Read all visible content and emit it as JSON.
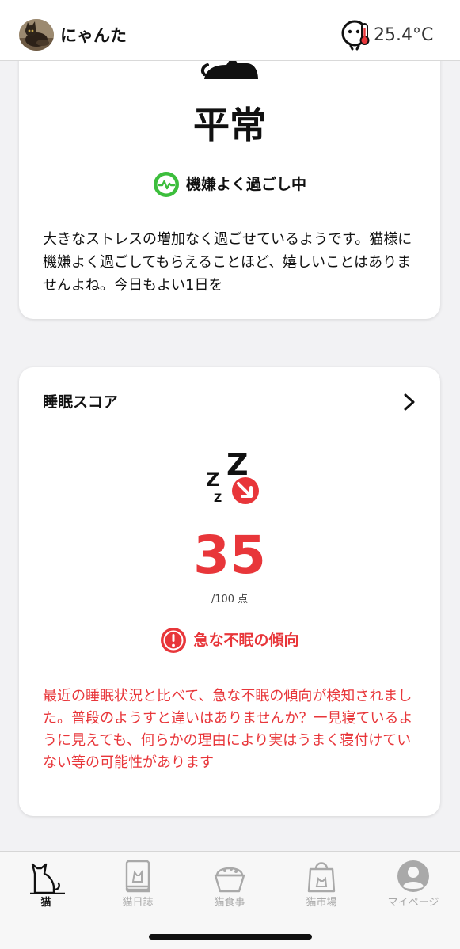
{
  "header": {
    "cat_name": "にゃんた",
    "temperature": "25.4°C"
  },
  "stress_card": {
    "level": "平常",
    "status": "機嫌よく過ごし中",
    "description": "大きなストレスの増加なく過ごせているようです。猫様に機嫌よく過ごしてもらえることほど、嬉しいことはありませんよね。今日もよい1日を"
  },
  "sleep_card": {
    "title": "睡眠スコア",
    "score": "35",
    "max": "/100 点",
    "alert": "急な不眠の傾向",
    "description": "最近の睡眠状況と比べて、急な不眠の傾向が検知されました。普段のようすと違いはありませんか？一見寝ているように見えても、何らかの理由により実はうまく寝付けていない等の可能性があります"
  },
  "nav": {
    "items": [
      {
        "label": "猫",
        "icon": "cat-icon",
        "active": true
      },
      {
        "label": "猫日誌",
        "icon": "diary-icon",
        "active": false
      },
      {
        "label": "猫食事",
        "icon": "food-bowl-icon",
        "active": false
      },
      {
        "label": "猫市場",
        "icon": "shopping-bag-icon",
        "active": false
      },
      {
        "label": "マイページ",
        "icon": "user-icon",
        "active": false
      }
    ]
  },
  "colors": {
    "accent_red": "#e8363a",
    "status_green": "#3cbe3c",
    "inactive_gray": "#a9a9a9"
  }
}
